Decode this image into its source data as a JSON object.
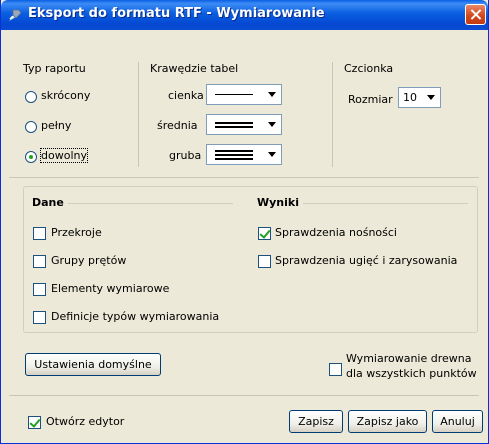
{
  "window": {
    "title": "Eksport do formatu RTF - Wymiarowanie",
    "close_icon": "close-icon"
  },
  "report_type": {
    "label": "Typ raportu",
    "options": [
      {
        "label": "skrócony",
        "selected": false
      },
      {
        "label": "pełny",
        "selected": false
      },
      {
        "label": "dowolny",
        "selected": true
      }
    ]
  },
  "table_edges": {
    "label": "Krawędzie tabel",
    "rows": [
      {
        "label": "cienka"
      },
      {
        "label": "średnia"
      },
      {
        "label": "gruba"
      }
    ]
  },
  "font": {
    "label": "Czcionka",
    "size_label": "Rozmiar",
    "size_value": "10"
  },
  "data_group": {
    "title": "Dane",
    "items": [
      {
        "label": "Przekroje",
        "checked": false
      },
      {
        "label": "Grupy prętów",
        "checked": false
      },
      {
        "label": "Elementy wymiarowe",
        "checked": false
      },
      {
        "label": "Definicje typów wymiarowania",
        "checked": false
      }
    ]
  },
  "results_group": {
    "title": "Wyniki",
    "items": [
      {
        "label": "Sprawdzenia nośności",
        "checked": true
      },
      {
        "label": "Sprawdzenia ugięć i zarysowania",
        "checked": false
      }
    ]
  },
  "defaults_button": "Ustawienia domyślne",
  "wood_option": {
    "line1": "Wymiarowanie drewna",
    "line2": "dla wszystkich punktów",
    "checked": false
  },
  "open_editor": {
    "label": "Otwórz edytor",
    "checked": true
  },
  "buttons": {
    "save": "Zapisz",
    "save_as": "Zapisz jako",
    "cancel": "Anuluj"
  }
}
